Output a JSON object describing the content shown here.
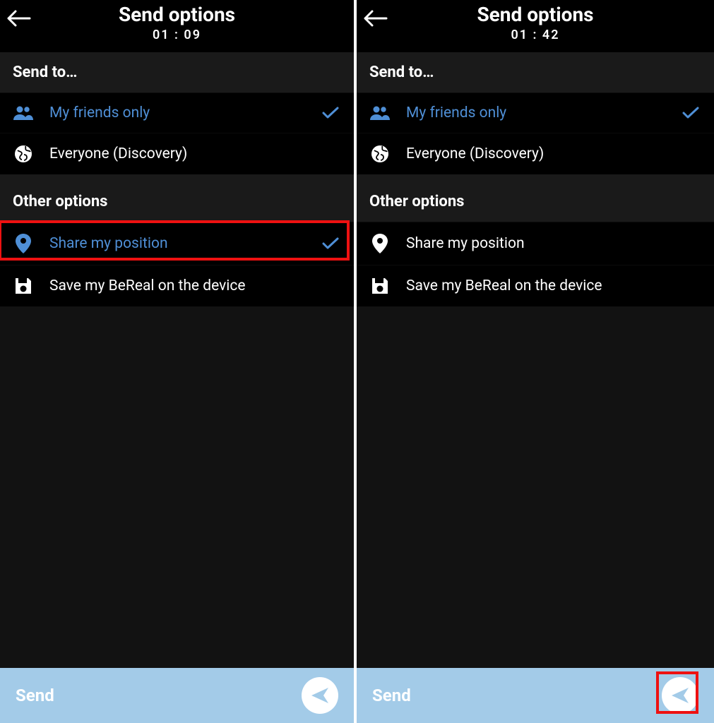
{
  "left": {
    "header": {
      "title": "Send options",
      "timer": "01 : 09"
    },
    "section_send_to": "Send to…",
    "friends": {
      "label": "My friends only",
      "selected": true
    },
    "everyone": {
      "label": "Everyone (Discovery)",
      "selected": false
    },
    "section_other": "Other options",
    "share_pos": {
      "label": "Share my position",
      "selected": true
    },
    "save_device": {
      "label": "Save my BeReal on the device",
      "selected": false
    },
    "send": "Send",
    "highlight": "share-position-row"
  },
  "right": {
    "header": {
      "title": "Send options",
      "timer": "01 : 42"
    },
    "section_send_to": "Send to…",
    "friends": {
      "label": "My friends only",
      "selected": true
    },
    "everyone": {
      "label": "Everyone (Discovery)",
      "selected": false
    },
    "section_other": "Other options",
    "share_pos": {
      "label": "Share my position",
      "selected": false
    },
    "save_device": {
      "label": "Save my BeReal on the device",
      "selected": false
    },
    "send": "Send",
    "highlight": "send-button"
  },
  "colors": {
    "accent": "#4f8fd6",
    "sendbar": "#a3cbe8",
    "highlight": "#e11"
  }
}
